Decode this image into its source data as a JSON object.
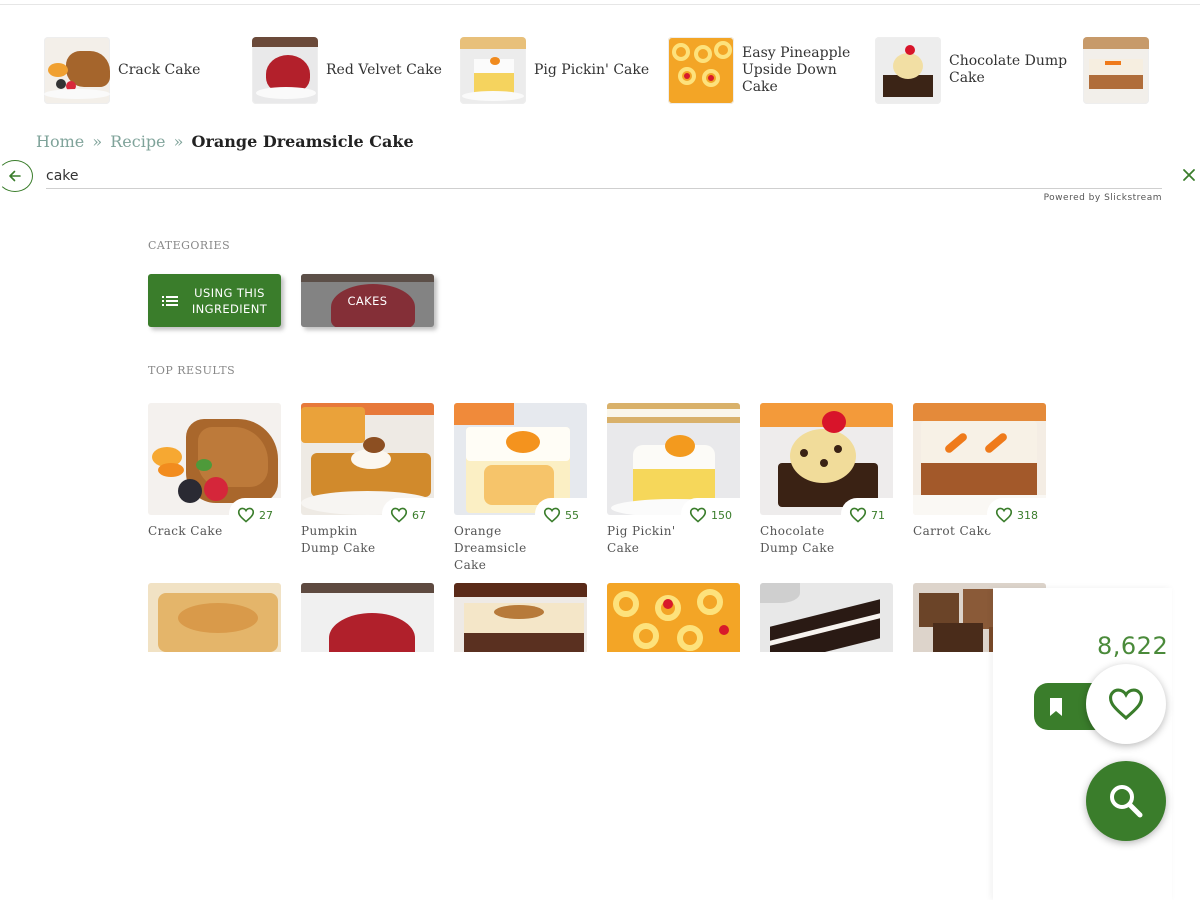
{
  "strip": {
    "items": [
      {
        "label": "Crack Cake",
        "image": "crack-cake-thumb"
      },
      {
        "label": "Red Velvet Cake",
        "image": "red-velvet-cake-thumb"
      },
      {
        "label": "Pig Pickin' Cake",
        "image": "pig-pickin-cake-thumb"
      },
      {
        "label": "Easy Pineapple Upside Down Cake",
        "image": "pineapple-upside-down-cake-thumb"
      },
      {
        "label": "Chocolate Dump Cake",
        "image": "chocolate-dump-cake-thumb"
      },
      {
        "label": "",
        "image": "carrot-cake-thumb"
      }
    ]
  },
  "breadcrumb": {
    "home": "Home",
    "separator": "»",
    "recipe": "Recipe",
    "current": "Orange Dreamsicle Cake"
  },
  "search": {
    "value": "cake",
    "powered_by": "Powered by Slickstream"
  },
  "categories": {
    "title": "CATEGORIES",
    "chips": [
      {
        "label": "USING THIS INGREDIENT",
        "icon": "list-icon"
      },
      {
        "label": "CAKES",
        "image": "red-velvet-cake"
      }
    ]
  },
  "results": {
    "title": "TOP RESULTS",
    "cards": [
      {
        "title": "Crack Cake",
        "likes": "27"
      },
      {
        "title": "Pumpkin Dump Cake",
        "likes": "67"
      },
      {
        "title": "Orange Dreamsicle Cake",
        "likes": "55"
      },
      {
        "title": "Pig Pickin' Cake",
        "likes": "150"
      },
      {
        "title": "Chocolate Dump Cake",
        "likes": "71"
      },
      {
        "title": "Carrot Cake",
        "likes": "318"
      }
    ]
  },
  "favorites": {
    "count": "8,622"
  },
  "colors": {
    "accent": "#3a7d2b",
    "link": "#7fa39a",
    "count_green": "#4a8a3a"
  }
}
